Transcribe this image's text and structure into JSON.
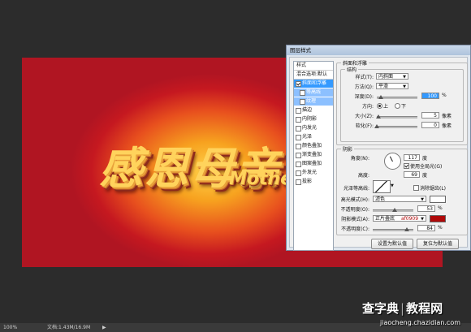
{
  "canvas": {
    "title_text": "感恩母亲",
    "subtitle_text": "Mothe"
  },
  "status_bar": {
    "zoom": "100%",
    "doc_label": "文档:1.43M/16.9M",
    "arrow": "▶"
  },
  "watermark": {
    "site": "查字典",
    "section": "教程网",
    "url": "jiaocheng.chazidian.com"
  },
  "dialog": {
    "title": "图层样式",
    "styles_list": {
      "header": "样式",
      "blend": "混合选项:默认",
      "items": [
        {
          "label": "斜面和浮雕",
          "checked": true,
          "selected": true,
          "sub": false
        },
        {
          "label": "等高线",
          "checked": false,
          "selected": false,
          "sub": true
        },
        {
          "label": "纹理",
          "checked": false,
          "selected": false,
          "sub": true
        },
        {
          "label": "描边",
          "checked": false,
          "selected": false,
          "sub": false
        },
        {
          "label": "内阴影",
          "checked": false,
          "selected": false,
          "sub": false
        },
        {
          "label": "内发光",
          "checked": false,
          "selected": false,
          "sub": false
        },
        {
          "label": "光泽",
          "checked": false,
          "selected": false,
          "sub": false
        },
        {
          "label": "颜色叠加",
          "checked": false,
          "selected": false,
          "sub": false
        },
        {
          "label": "渐变叠加",
          "checked": false,
          "selected": false,
          "sub": false
        },
        {
          "label": "图案叠加",
          "checked": false,
          "selected": false,
          "sub": false
        },
        {
          "label": "外发光",
          "checked": false,
          "selected": false,
          "sub": false
        },
        {
          "label": "投影",
          "checked": false,
          "selected": false,
          "sub": false
        }
      ]
    },
    "bevel": {
      "group_title": "斜面和浮雕",
      "structure_title": "结构",
      "style_label": "样式(T):",
      "style_value": "内斜面",
      "technique_label": "方法(Q):",
      "technique_value": "平滑",
      "depth_label": "深度(D):",
      "depth_value": "100",
      "depth_unit": "%",
      "depth_fraction": 0.1,
      "direction_label": "方向:",
      "direction_up": "上",
      "direction_down": "下",
      "size_label": "大小(Z):",
      "size_value": "5",
      "size_unit": "像素",
      "size_fraction": 0.03,
      "soften_label": "软化(F):",
      "soften_value": "0",
      "soften_unit": "像素",
      "soften_fraction": 0.0
    },
    "shading": {
      "title": "阴影",
      "angle_label": "角度(N):",
      "angle_value": "117",
      "angle_unit": "度",
      "global_light_label": "使用全局光(G)",
      "altitude_label": "高度:",
      "altitude_value": "69",
      "altitude_unit": "度",
      "gloss_label": "光泽等高线:",
      "antialias_label": "消除锯齿(L)",
      "highlight_mode_label": "高光模式(H):",
      "highlight_mode_value": "滤色",
      "highlight_color": "#ffffff",
      "highlight_opacity_label": "不透明度(O):",
      "highlight_opacity_value": "53",
      "highlight_opacity_fraction": 0.53,
      "shadow_mode_label": "阴影模式(A):",
      "shadow_mode_value": "正片叠底",
      "shadow_color_label": "af0909",
      "shadow_color": "#af0909",
      "shadow_opacity_label": "不透明度(C):",
      "shadow_opacity_value": "84",
      "shadow_opacity_fraction": 0.84,
      "percent": "%"
    },
    "buttons": {
      "set_default": "设置为默认值",
      "reset_default": "复位为默认值"
    }
  }
}
